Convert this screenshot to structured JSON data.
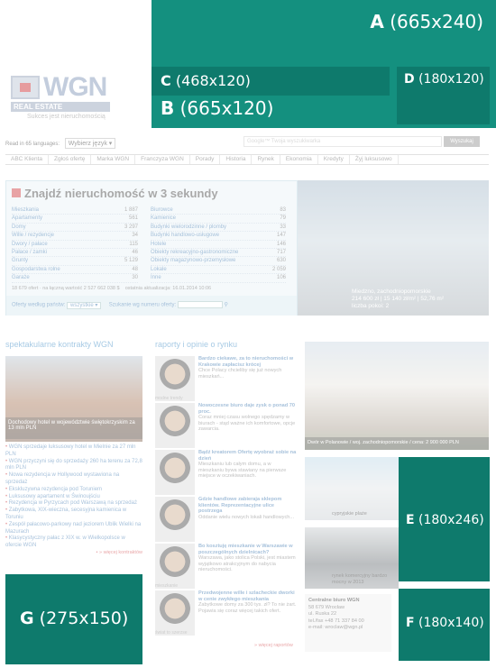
{
  "ads": {
    "a": {
      "letter": "A",
      "size": "(665x240)"
    },
    "b": {
      "letter": "B",
      "size": "(665x120)"
    },
    "c": {
      "letter": "C",
      "size": "(468x120)"
    },
    "d": {
      "letter": "D",
      "size": "(180x120)"
    },
    "e": {
      "letter": "E",
      "size": "(180x246)"
    },
    "f": {
      "letter": "F",
      "size": "(180x140)"
    },
    "g": {
      "letter": "G",
      "size": "(275x150)"
    }
  },
  "logo": {
    "brand": "WGN",
    "sub": "REAL ESTATE",
    "tagline": "Sukces jest nieruchomością"
  },
  "header": {
    "lang_label": "Read in 65 languages:",
    "translate_label": "Wybierz język",
    "search_placeholder": "Google™ Twoja wyszukiwarka",
    "search_button": "Wyszukaj"
  },
  "nav": [
    "ABC Klienta",
    "Zgłoś ofertę",
    "Marka WGN",
    "Franczyza WGN",
    "Porady",
    "Historia",
    "Rynek",
    "Ekonomia",
    "Kredyty",
    "Żyj luksusowo"
  ],
  "finder": {
    "title": "Znajdź nieruchomość w 3 sekundy",
    "left": [
      {
        "name": "Mieszkania",
        "count": "1 887"
      },
      {
        "name": "Apartamenty",
        "count": "561"
      },
      {
        "name": "Domy",
        "count": "3 297"
      },
      {
        "name": "Wille / rezydencje",
        "count": "34"
      },
      {
        "name": "Dwory / pałace",
        "count": "115"
      },
      {
        "name": "Pałace / zamki",
        "count": "46"
      },
      {
        "name": "Grunty",
        "count": "5 129"
      },
      {
        "name": "Gospodarstwa rolne",
        "count": "48"
      },
      {
        "name": "Garaże",
        "count": "30"
      }
    ],
    "right": [
      {
        "name": "Biurowce",
        "count": "83"
      },
      {
        "name": "Kamienice",
        "count": "79"
      },
      {
        "name": "Budynki wielorodzinne / plomby",
        "count": "33"
      },
      {
        "name": "Budynki handlowo-usługowe",
        "count": "147"
      },
      {
        "name": "Hotele",
        "count": "146"
      },
      {
        "name": "Obiekty rekreacyjno-gastronomiczne",
        "count": "717"
      },
      {
        "name": "Obiekty magazynowo-przemysłowe",
        "count": "630"
      },
      {
        "name": "Lokale",
        "count": "2 059"
      },
      {
        "name": "Inne",
        "count": "106"
      }
    ],
    "stat_left": "18 679 ofert · na łączną wartość 2 527 662 038 $",
    "stat_right": "ostatnia aktualizacja: 16.01.2014 10:06",
    "country_label": "Oferty według państw:",
    "country_value": "wszystkie",
    "number_label": "Szukanie wg numeru oferty:"
  },
  "hero": {
    "caption1": "Miedzno, zachodniopomorskie",
    "caption2": "214 600 zł | 15 140 zł/m² | 52,76 m²",
    "caption3": "liczba pokoi: 2"
  },
  "left_col": {
    "title": "spektakularne kontrakty WGN",
    "photo_caption": "Dochodowy hotel w województwie świętokrzyskim za 13 mln PLN",
    "items": [
      "WGN sprzedaje luksusowy hotel w Mielnie za 27 mln PLN",
      "WGN przyczyni się do sprzedaży 260 ha terenu za 72,8 mln PLN",
      "Nowa rezydencja w Hollywood wystawiona na sprzedaż",
      "Ekskluzywna rezydencja pod Toruniem",
      "Luksusowy apartament w Świnoujściu",
      "Rezydencja w Pyrzycach pod Warszawą na sprzedaż",
      "Zabytkowa, XIX-wieczna, secesyjna kamienica w Toruniu",
      "Zespół pałacowo-parkowy nad jeziorem Ublik Wielki na Mazurach",
      "Klasycystyczny pałac z XIX w. w Wielkopolsce w ofercie WGN"
    ],
    "more": "» więcej kontraktów"
  },
  "mid_col": {
    "title": "raporty i opinie o rynku",
    "reports": [
      {
        "head": "Bardzo ciekawe, za to nieruchomości w Krakowie zapłacisz krócej",
        "body": "Chce Polacy chcieliby się już nowych mieszkań...",
        "tag": "modne trendy"
      },
      {
        "head": "Nowoczesne biuro daje zysk o ponad 70 proc.",
        "body": "Coraz mniej czasu wolnego spędzamy w biurach - stąd ważne ich komfortowe, opcje zawarcia.",
        "tag": ""
      },
      {
        "head": "Bądź kreatorem Ofertę wyobraź sobie na dzień",
        "body": "Mieszkaniu lub całym domu, a w mieszkaniu bywa stawiany na pierwsze miejsce w oczekiwaniach.",
        "tag": ""
      },
      {
        "head": "Gdzie handlowe zabieraja sklepom klientów. Reprezentacyjne ulice postrzega",
        "body": "Oddanie wielu nowych lokali handlowych...",
        "tag": ""
      },
      {
        "head": "Bo kosztuję mieszkanie w Warszawie w poszczególnych dzielnicach?",
        "body": "Warszawa, jako stolica Polski, jest miastem wyjątkowo atrakcyjnym do nabycia nieruchomości.",
        "tag": "mieszkanie"
      },
      {
        "head": "Przedwojenne wille i szlacheckie dworki w cenie zwykłego mieszkania",
        "body": "Zabytkowe domy za 300 tys. zł? To nie żart. Pojawia się coraz więcej takich ofert.",
        "tag": "świat to szerzse"
      }
    ],
    "more": "» więcej raportów"
  },
  "right_col": {
    "photo_caption": "Dwór w Polanowie / woj. zachodniopomorskie / cena: 2 900 000 PLN",
    "thumb1": "cypryjskie plaże",
    "thumb2": "rynek komercyjny bardzo mocny w 2013",
    "office_title": "Centralne biuro WGN",
    "office_lines": [
      "58 679 Wrocław",
      "ul. Ruska 22",
      "tel./fax +48 71 337 84 00",
      "e-mail: wroclaw@wgn.pl"
    ]
  }
}
